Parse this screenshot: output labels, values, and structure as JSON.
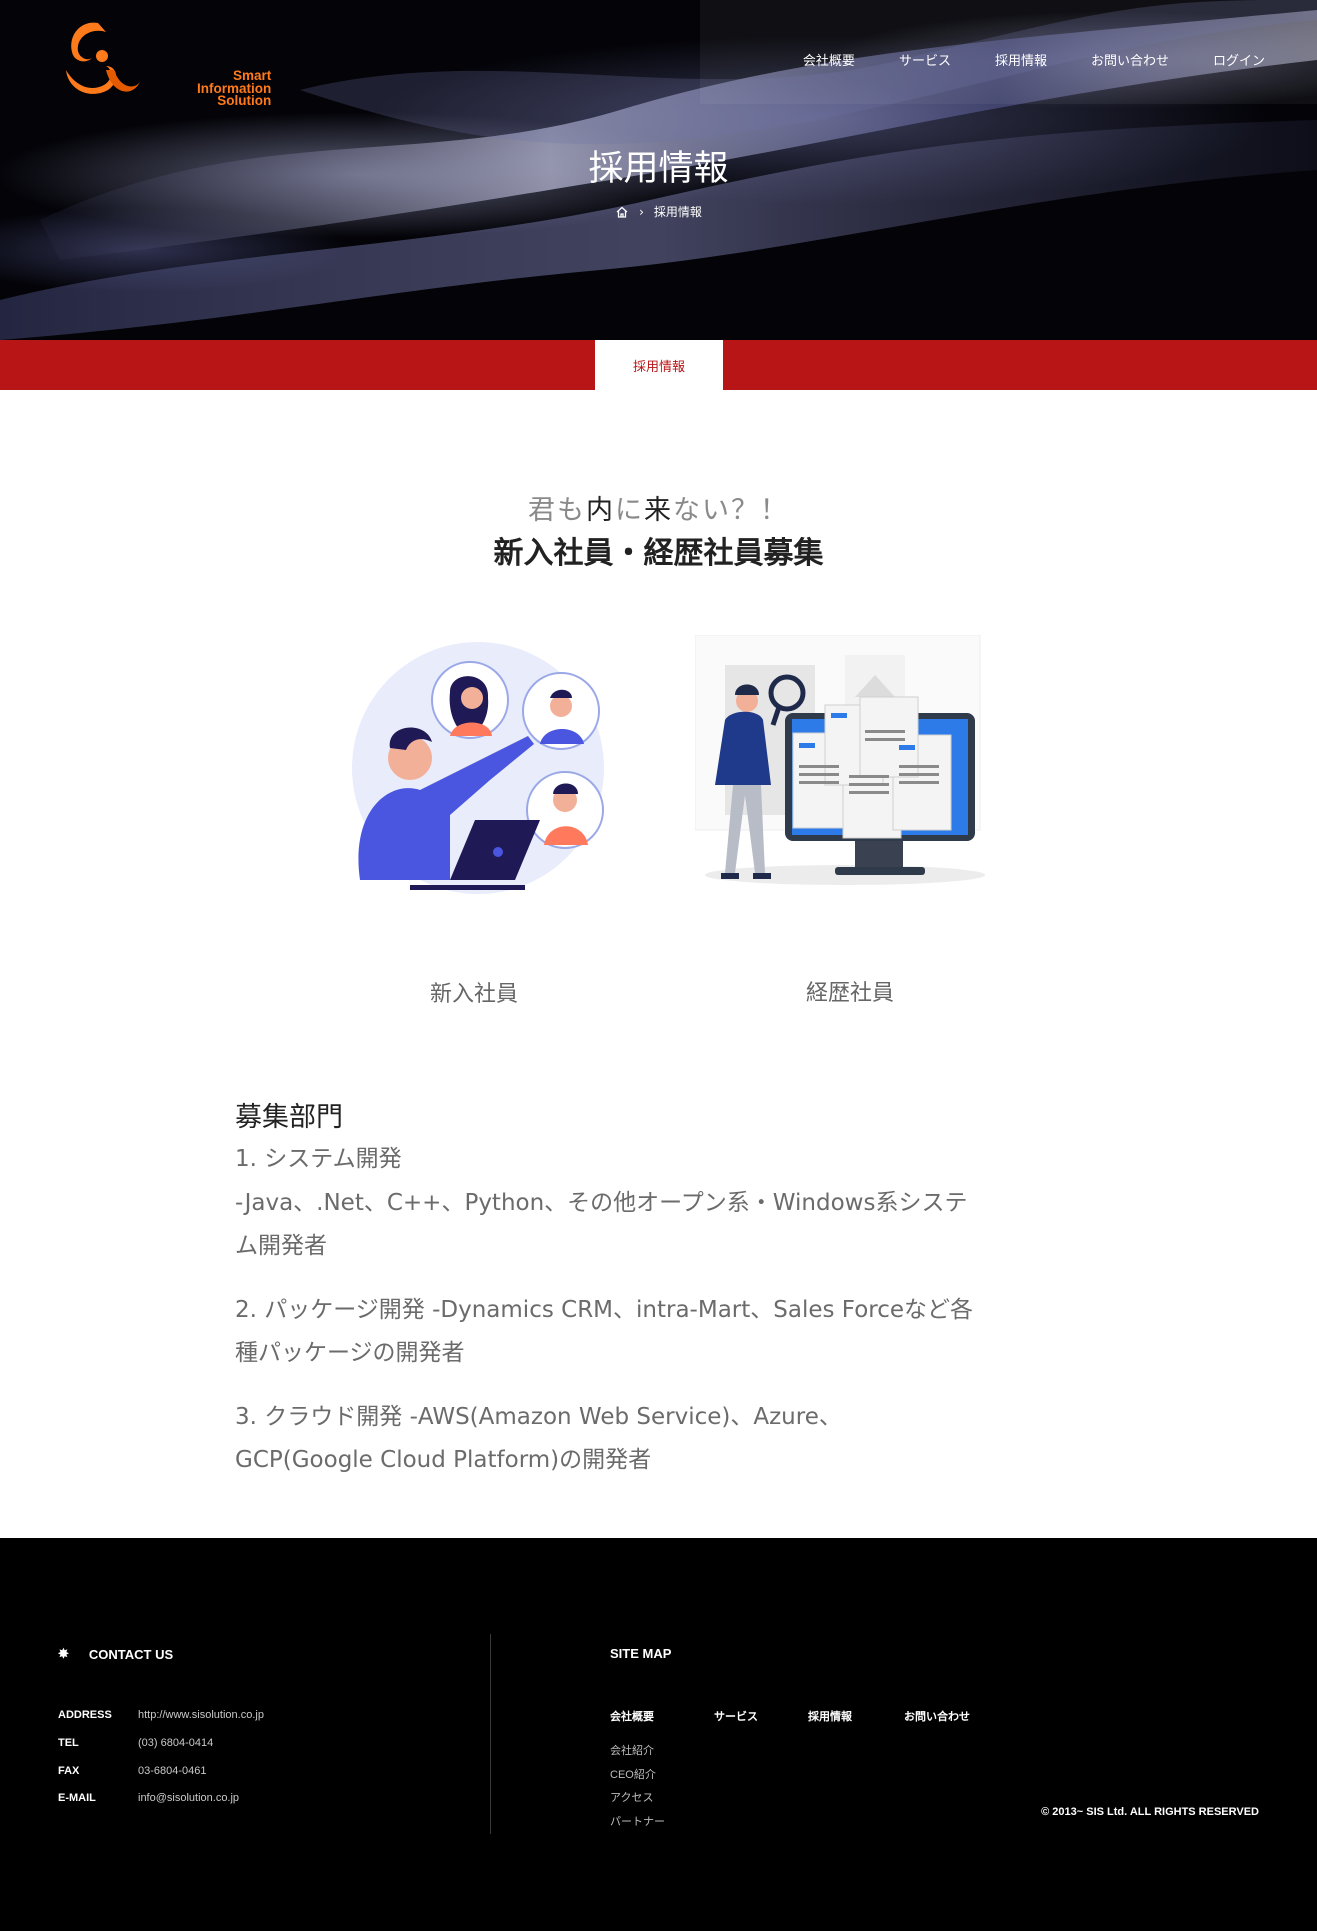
{
  "header": {
    "logo_text": [
      "Smart",
      "Information",
      "Solution"
    ],
    "nav": [
      "会社概要",
      "サービス",
      "採用情報",
      "お問い合わせ",
      "ログイン"
    ],
    "title": "採用情報",
    "breadcrumb_current": "採用情報"
  },
  "tabbar": {
    "active_tab": "採用情報"
  },
  "main": {
    "tagline_parts": [
      "君も",
      "内",
      "に",
      "来",
      "ない？！"
    ],
    "headline": "新入社員・経歴社員募集",
    "cards": [
      {
        "caption": "新入社員"
      },
      {
        "caption": "経歴社員"
      }
    ],
    "section_title": "募集部門",
    "items": [
      "1. システム開発",
      "-Java、.Net、C++、Python、その他オープン系・Windows系システム開発者",
      "2. パッケージ開発 -Dynamics CRM、intra-Mart、Sales Forceなど各種パッケージの開発者",
      "3. クラウド開発 -AWS(Amazon Web Service)、Azure、GCP(Google Cloud Platform)の開発者"
    ]
  },
  "footer": {
    "contact_heading": "CONTACT US",
    "contact": [
      {
        "label": "ADDRESS",
        "value": "http://www.sisolution.co.jp"
      },
      {
        "label": "TEL",
        "value": "(03) 6804-0414"
      },
      {
        "label": "FAX",
        "value": "03-6804-0461"
      },
      {
        "label": "E-MAIL",
        "value": "info@sisolution.co.jp"
      }
    ],
    "sitemap_heading": "SITE MAP",
    "sitemap_main": [
      "会社概要",
      "サービス",
      "採用情報",
      "お問い合わせ"
    ],
    "sitemap_sub": [
      "会社紹介",
      "CEO紹介",
      "アクセス",
      "パートナー"
    ],
    "copyright": "© 2013~ SIS Ltd. ALL RIGHTS RESERVED"
  },
  "colors": {
    "accent_red": "#b81517",
    "logo_orange": "#ff7a1a"
  }
}
